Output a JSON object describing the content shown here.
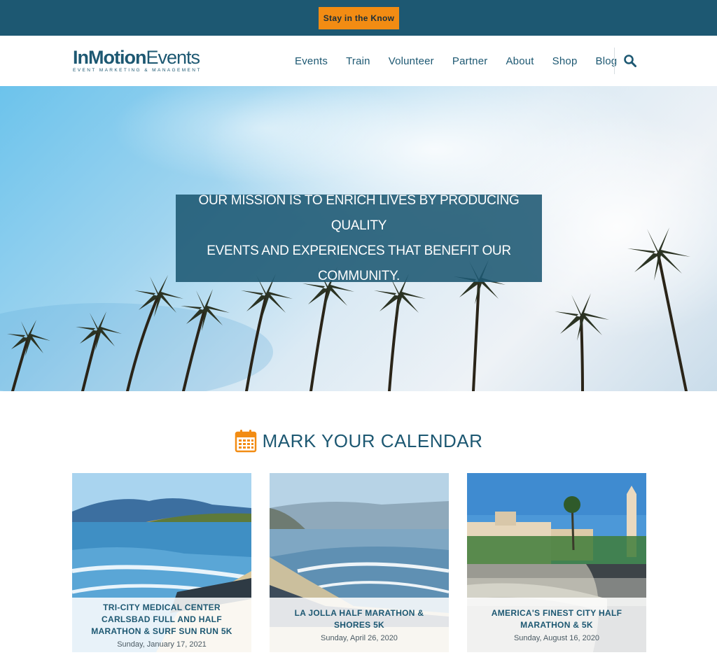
{
  "topbar": {
    "cta_label": "Stay in the Know"
  },
  "header": {
    "logo_bold": "InMotion",
    "logo_light": "Events",
    "logo_tagline": "EVENT MARKETING & MANAGEMENT",
    "nav": [
      "Events",
      "Train",
      "Volunteer",
      "Partner",
      "About",
      "Shop",
      "Blog"
    ],
    "search_icon": "search-icon"
  },
  "hero": {
    "mission_line1": "Our mission is to enrich lives by producing quality",
    "mission_line2": "events and experiences that benefit our community."
  },
  "calendar": {
    "icon": "calendar-icon",
    "title": "MARK YOUR CALENDAR",
    "events": [
      {
        "title": "Tri-City Medical Center Carlsbad Full and Half Marathon & Surf Sun Run 5K",
        "date": "Sunday, January 17, 2021"
      },
      {
        "title": "La Jolla Half Marathon & Shores 5K",
        "date": "Sunday, April 26, 2020"
      },
      {
        "title": "America's Finest City Half Marathon & 5K",
        "date": "Sunday, August 16, 2020"
      }
    ]
  },
  "colors": {
    "brand": "#1d5872",
    "accent": "#f28c13"
  }
}
